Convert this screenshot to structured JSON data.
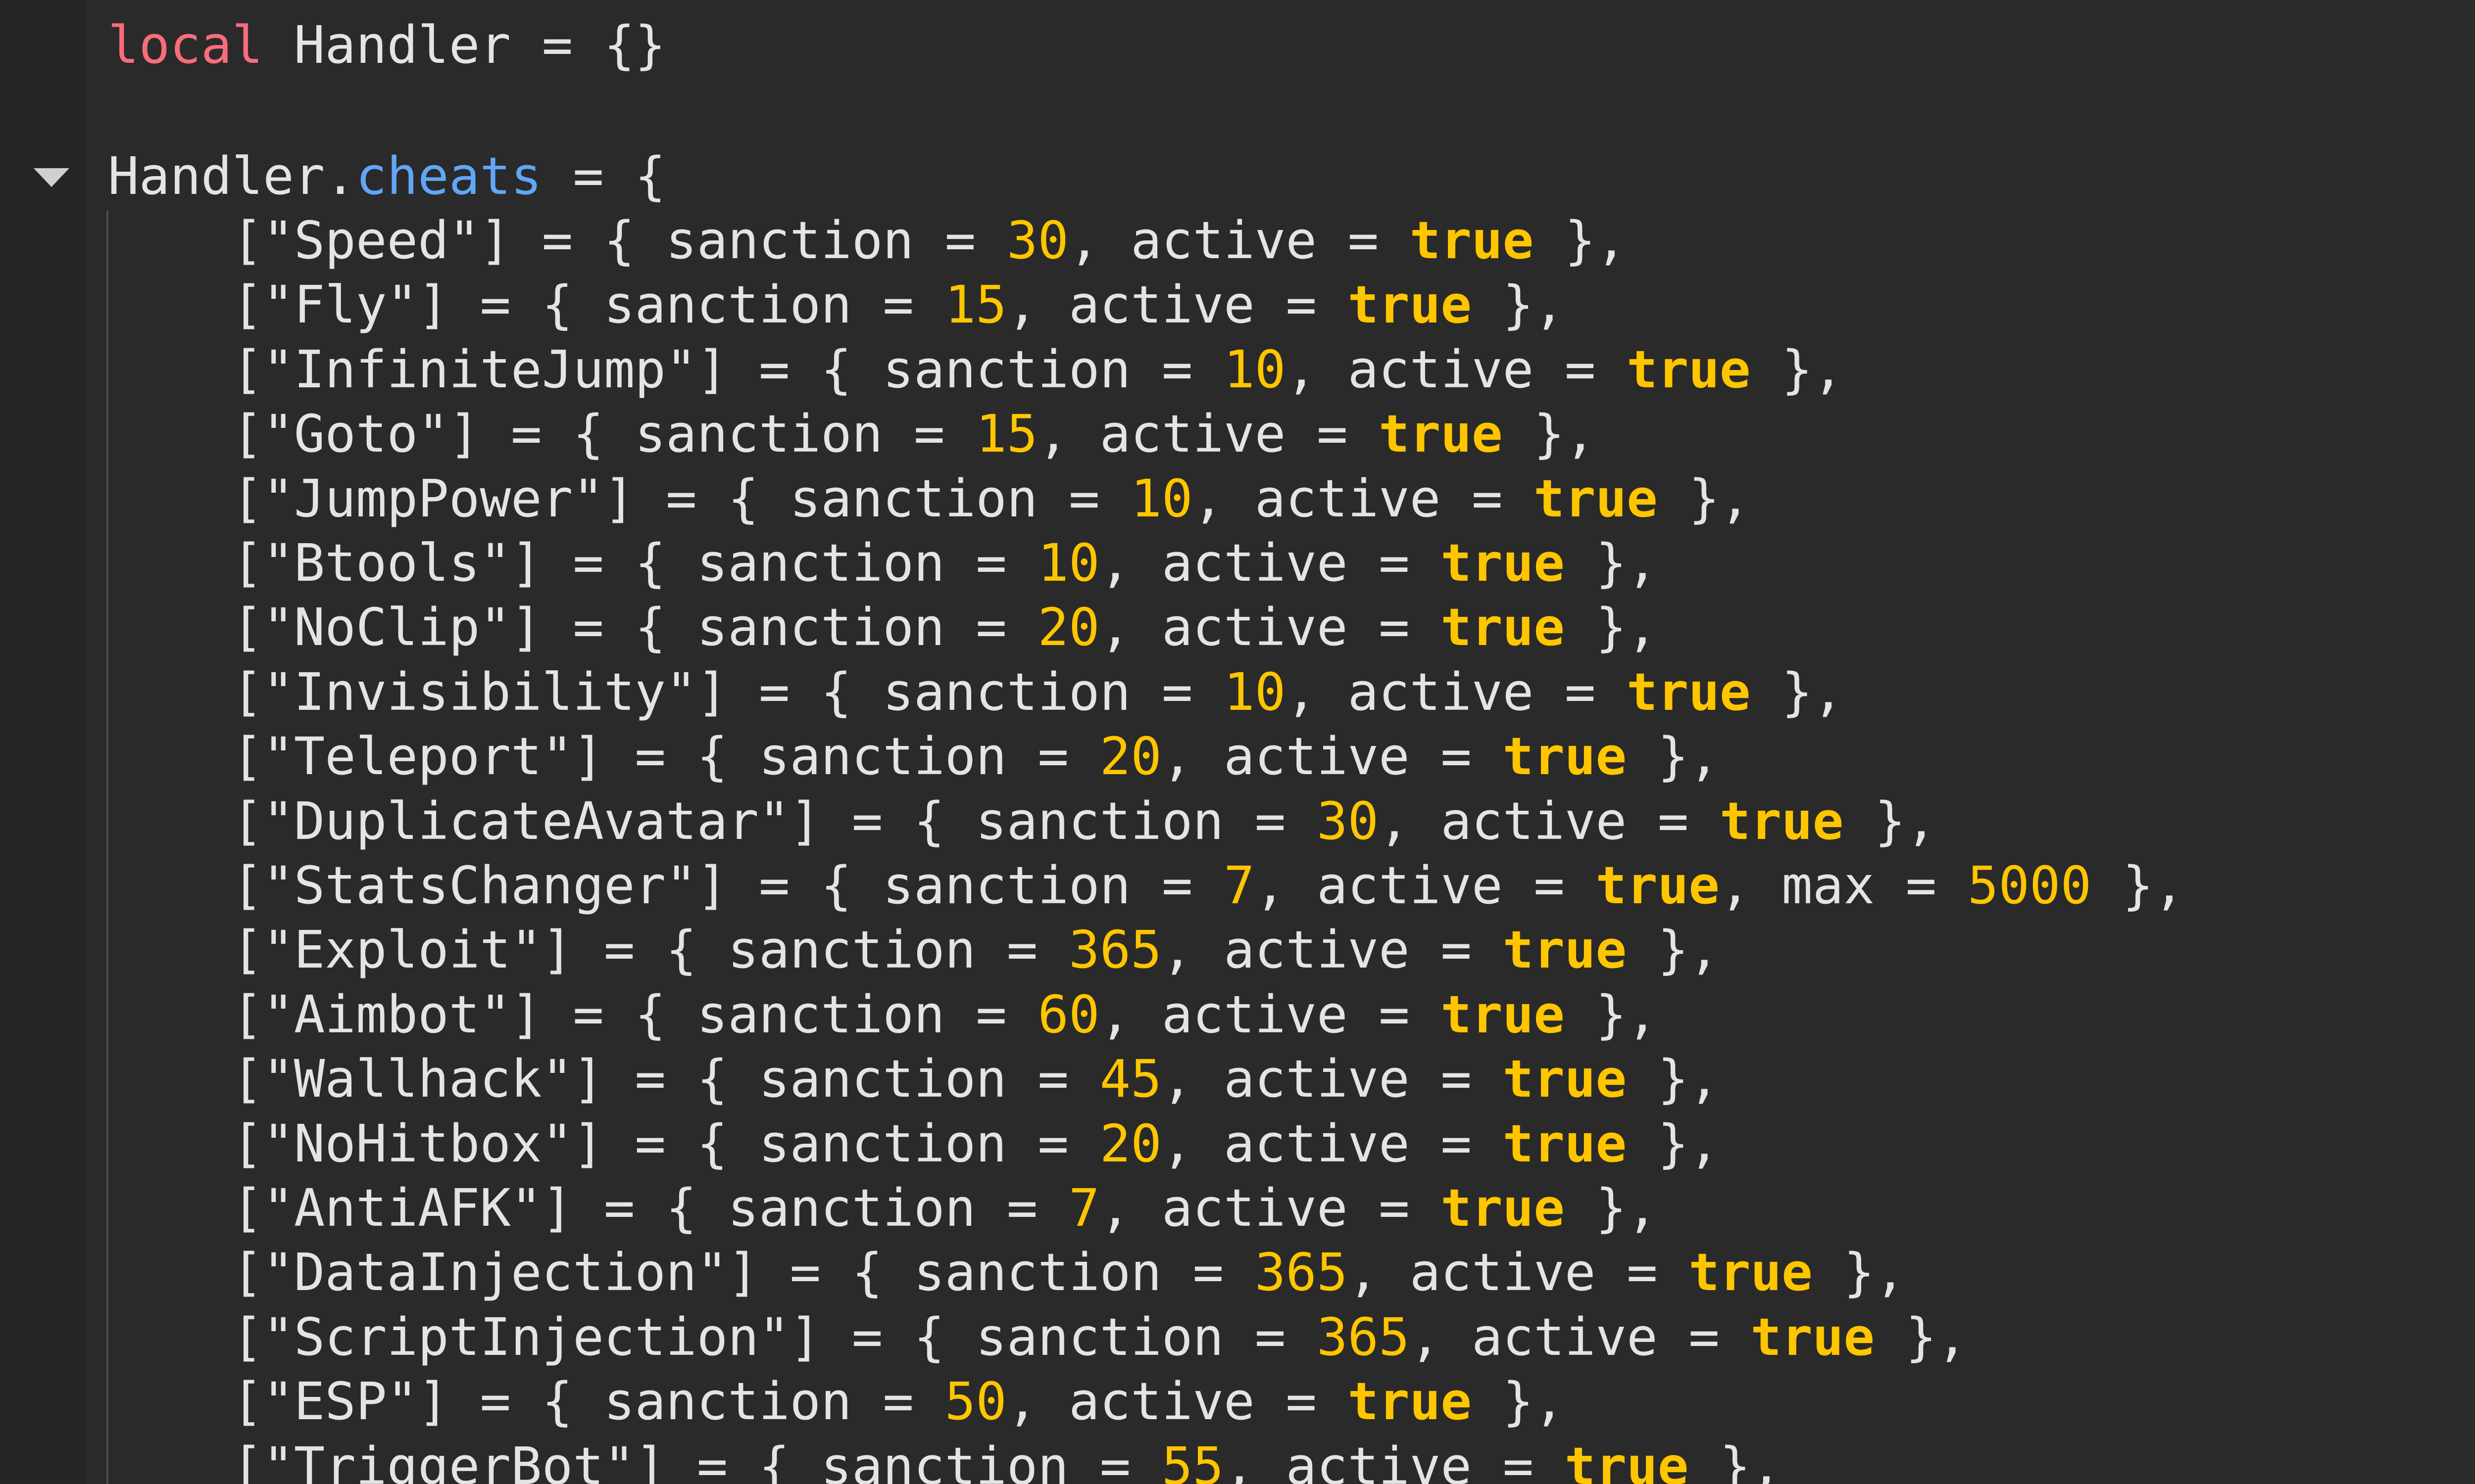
{
  "code": {
    "line1": {
      "kw": "local",
      "rest": " Handler = {}"
    },
    "line3": {
      "obj": "Handler.",
      "prop": "cheats",
      "rest": " = {"
    },
    "entries": [
      {
        "name": "Speed",
        "sanction": "30",
        "active": "true",
        "max": null
      },
      {
        "name": "Fly",
        "sanction": "15",
        "active": "true",
        "max": null
      },
      {
        "name": "InfiniteJump",
        "sanction": "10",
        "active": "true",
        "max": null
      },
      {
        "name": "Goto",
        "sanction": "15",
        "active": "true",
        "max": null
      },
      {
        "name": "JumpPower",
        "sanction": "10",
        "active": "true",
        "max": null
      },
      {
        "name": "Btools",
        "sanction": "10",
        "active": "true",
        "max": null
      },
      {
        "name": "NoClip",
        "sanction": "20",
        "active": "true",
        "max": null
      },
      {
        "name": "Invisibility",
        "sanction": "10",
        "active": "true",
        "max": null
      },
      {
        "name": "Teleport",
        "sanction": "20",
        "active": "true",
        "max": null
      },
      {
        "name": "DuplicateAvatar",
        "sanction": "30",
        "active": "true",
        "max": null
      },
      {
        "name": "StatsChanger",
        "sanction": "7",
        "active": "true",
        "max": "5000"
      },
      {
        "name": "Exploit",
        "sanction": "365",
        "active": "true",
        "max": null
      },
      {
        "name": "Aimbot",
        "sanction": "60",
        "active": "true",
        "max": null
      },
      {
        "name": "Wallhack",
        "sanction": "45",
        "active": "true",
        "max": null
      },
      {
        "name": "NoHitbox",
        "sanction": "20",
        "active": "true",
        "max": null
      },
      {
        "name": "AntiAFK",
        "sanction": "7",
        "active": "true",
        "max": null
      },
      {
        "name": "DataInjection",
        "sanction": "365",
        "active": "true",
        "max": null
      },
      {
        "name": "ScriptInjection",
        "sanction": "365",
        "active": "true",
        "max": null
      },
      {
        "name": "ESP",
        "sanction": "50",
        "active": "true",
        "max": null
      },
      {
        "name": "TriggerBot",
        "sanction": "55",
        "active": "true",
        "max": null
      }
    ]
  },
  "icons": {
    "fold": "fold-arrow-icon"
  },
  "colors": {
    "background": "#2a2a2a",
    "keyword": "#f86d7c",
    "property": "#61a6f8",
    "number": "#ffc600",
    "text": "#e4e4e4"
  }
}
